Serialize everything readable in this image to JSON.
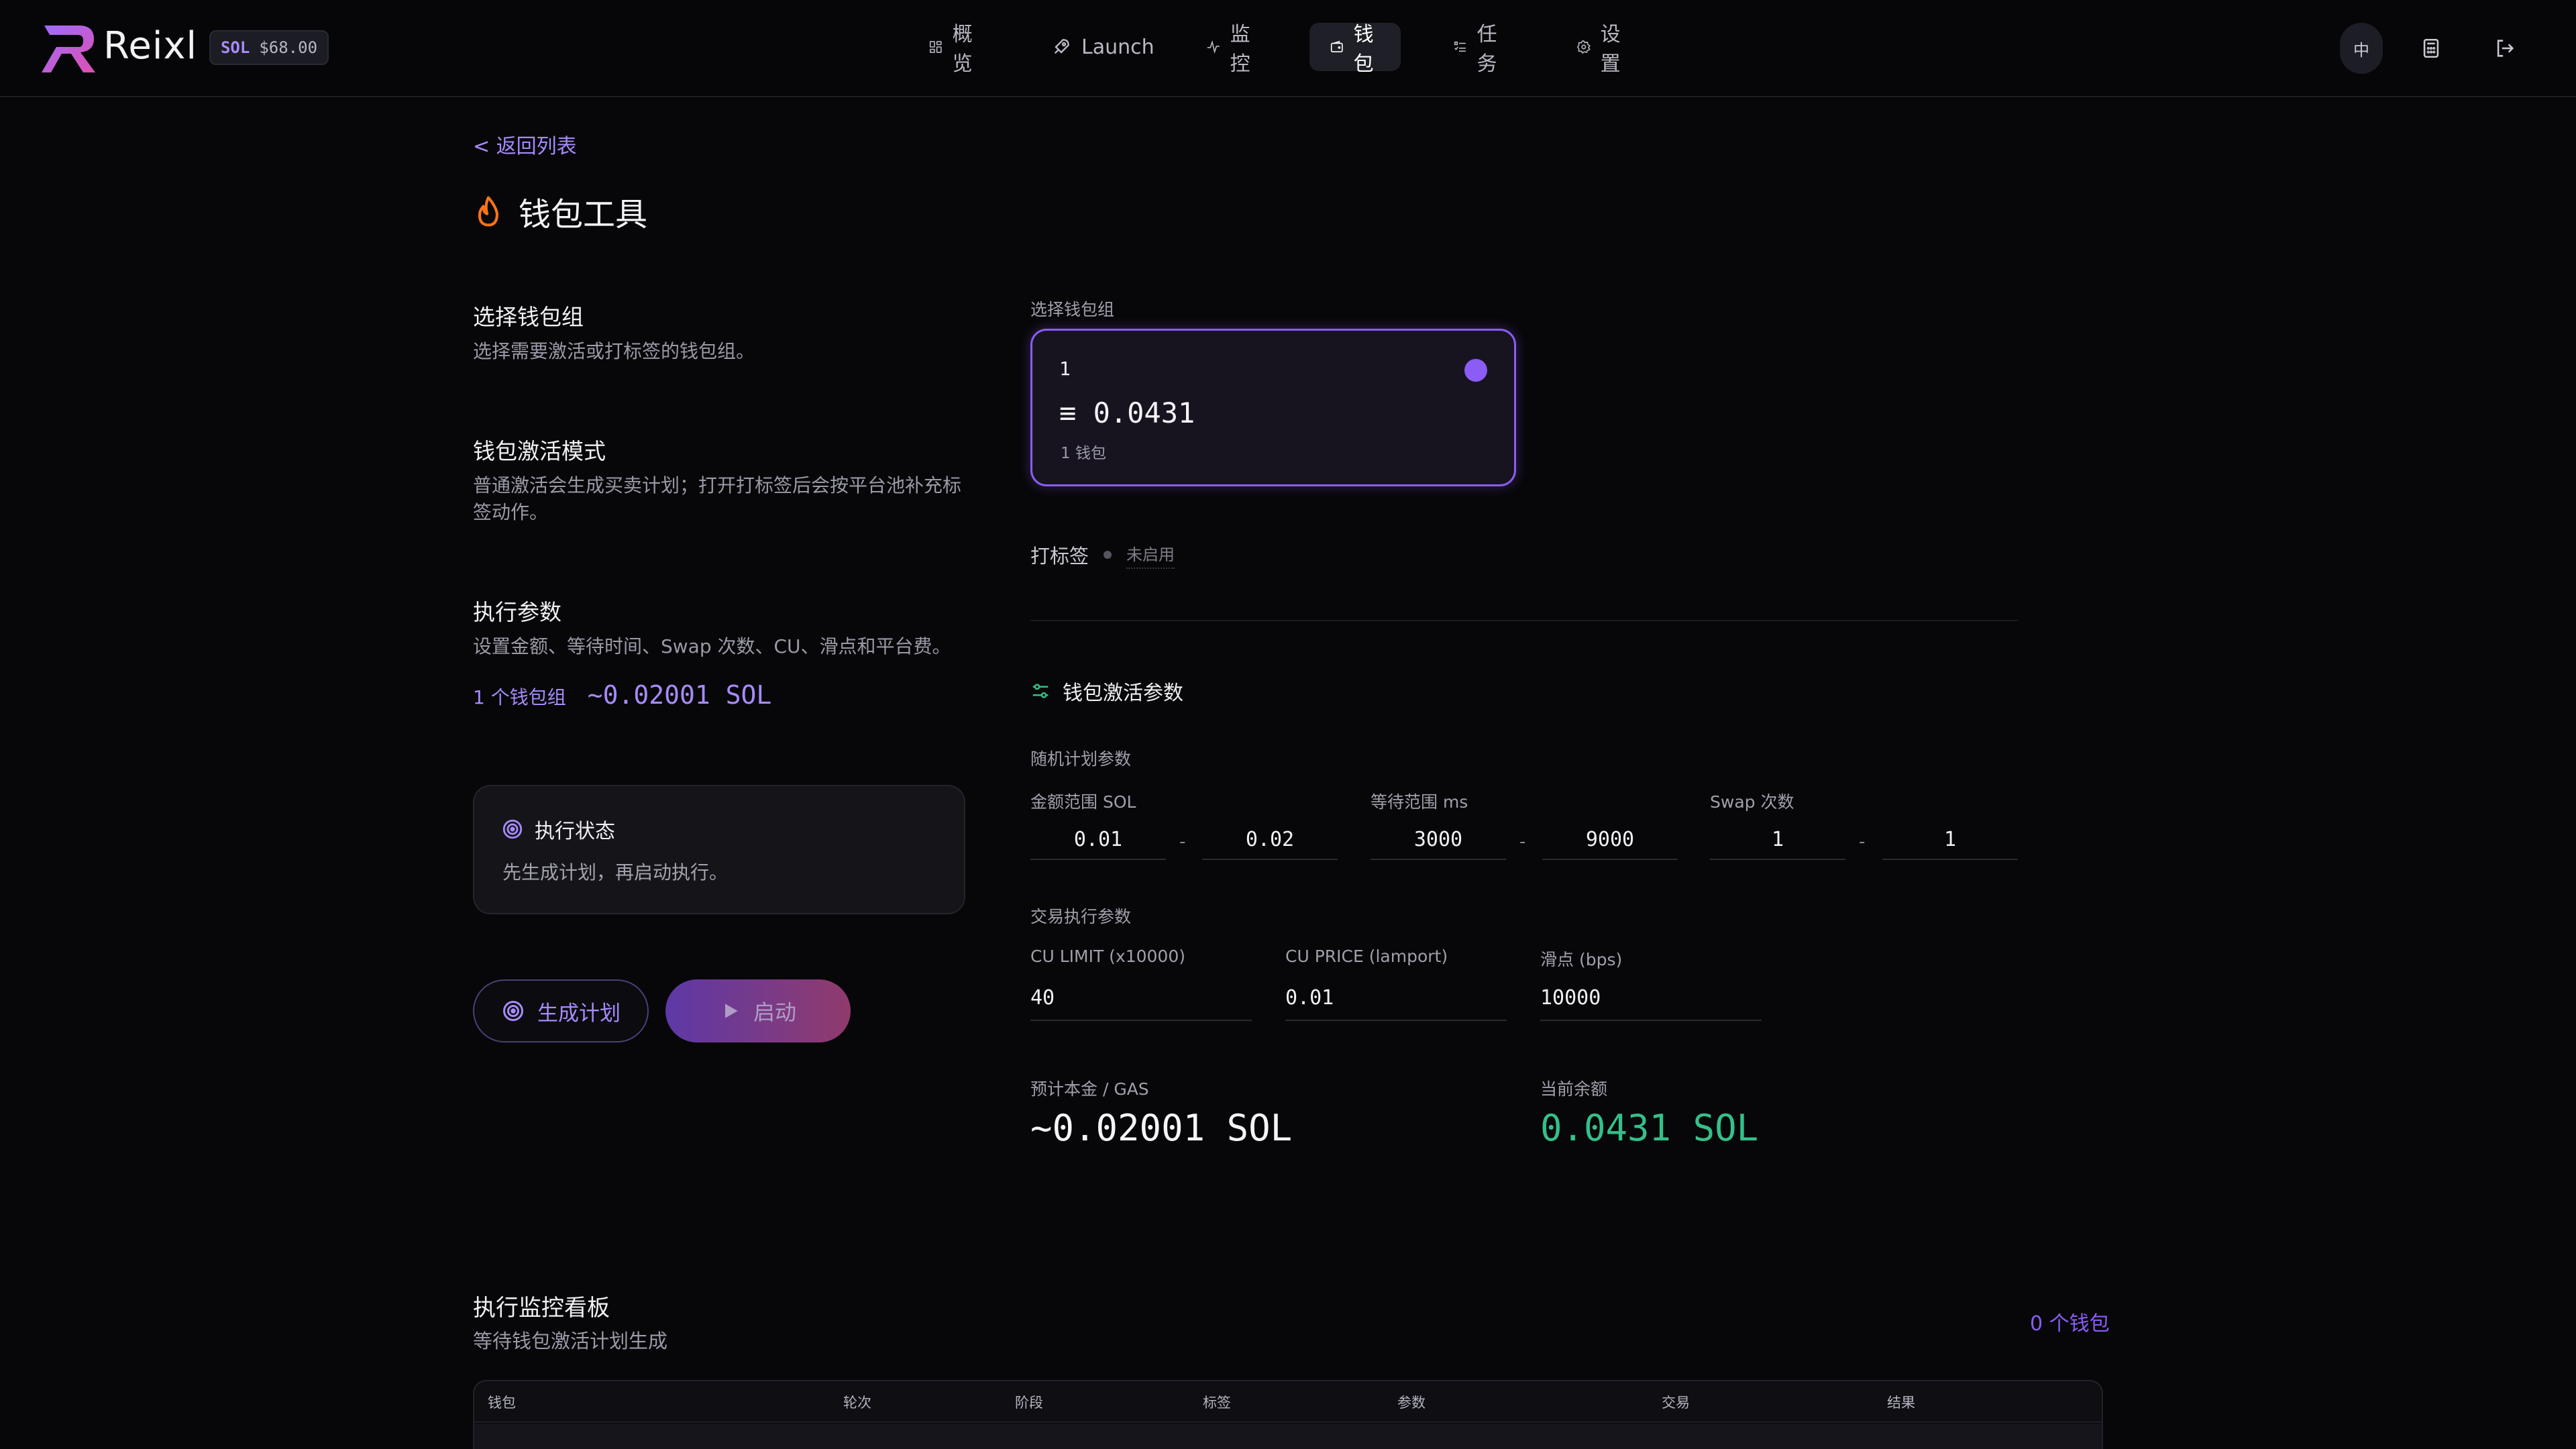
{
  "header": {
    "logo_text": "Reixl",
    "sol_badge": {
      "label": "SOL",
      "value": "$68.00"
    },
    "nav": [
      {
        "label": "概览",
        "icon": "grid-icon"
      },
      {
        "label": "Launch",
        "icon": "rocket-icon"
      },
      {
        "label": "监控",
        "icon": "activity-icon"
      },
      {
        "label": "钱包",
        "icon": "wallet-icon",
        "active": true
      },
      {
        "label": "任务",
        "icon": "list-icon"
      },
      {
        "label": "设置",
        "icon": "gear-icon"
      }
    ],
    "lang_button": "中",
    "calculator_icon": "calculator-icon",
    "logout_icon": "logout-icon"
  },
  "page": {
    "back_link": "< 返回列表",
    "title": "钱包工具",
    "title_icon": "flame-icon"
  },
  "left": {
    "select_group": {
      "title": "选择钱包组",
      "desc": "选择需要激活或打标签的钱包组。"
    },
    "activation_mode": {
      "title": "钱包激活模式",
      "desc": "普通激活会生成买卖计划；打开打标签后会按平台池补充标签动作。"
    },
    "exec_params": {
      "title": "执行参数",
      "desc": "设置金额、等待时间、Swap 次数、CU、滑点和平台费。"
    },
    "summary": {
      "groups": "1 个钱包组",
      "amount": "~0.02001 SOL"
    },
    "status": {
      "title": "执行状态",
      "desc": "先生成计划，再启动执行。"
    },
    "buttons": {
      "generate": "生成计划",
      "start": "启动"
    }
  },
  "right": {
    "select_label": "选择钱包组",
    "wallet_card": {
      "name": "1",
      "balance": "≡ 0.0431",
      "count": "1 钱包",
      "selected": true
    },
    "tagging": {
      "label": "打标签",
      "state": "未启用"
    },
    "params_title": "钱包激活参数",
    "random_plan_label": "随机计划参数",
    "amount_range": {
      "label": "金额范围 SOL",
      "min": "0.01",
      "max": "0.02"
    },
    "wait_range": {
      "label": "等待范围 ms",
      "min": "3000",
      "max": "9000"
    },
    "swap_count": {
      "label": "Swap 次数",
      "min": "1",
      "max": "1"
    },
    "range_sep": "-",
    "exec_label": "交易执行参数",
    "cu_limit": {
      "label": "CU LIMIT (x10000)",
      "value": "40"
    },
    "cu_price": {
      "label": "CU PRICE (lamport)",
      "value": "0.01"
    },
    "slippage": {
      "label": "滑点 (bps)",
      "value": "10000"
    },
    "estimate": {
      "label": "预计本金 / GAS",
      "value": "~0.02001 SOL"
    },
    "balance": {
      "label": "当前余额",
      "value": "0.0431 SOL"
    }
  },
  "monitor": {
    "title": "执行监控看板",
    "desc": "等待钱包激活计划生成",
    "count": "0 个钱包",
    "columns": [
      "钱包",
      "轮次",
      "阶段",
      "标签",
      "参数",
      "交易",
      "结果"
    ]
  },
  "colors": {
    "accent": "#8b5cf6",
    "accent_text": "#a78bfa",
    "success": "#34c08a",
    "background": "#070709"
  }
}
